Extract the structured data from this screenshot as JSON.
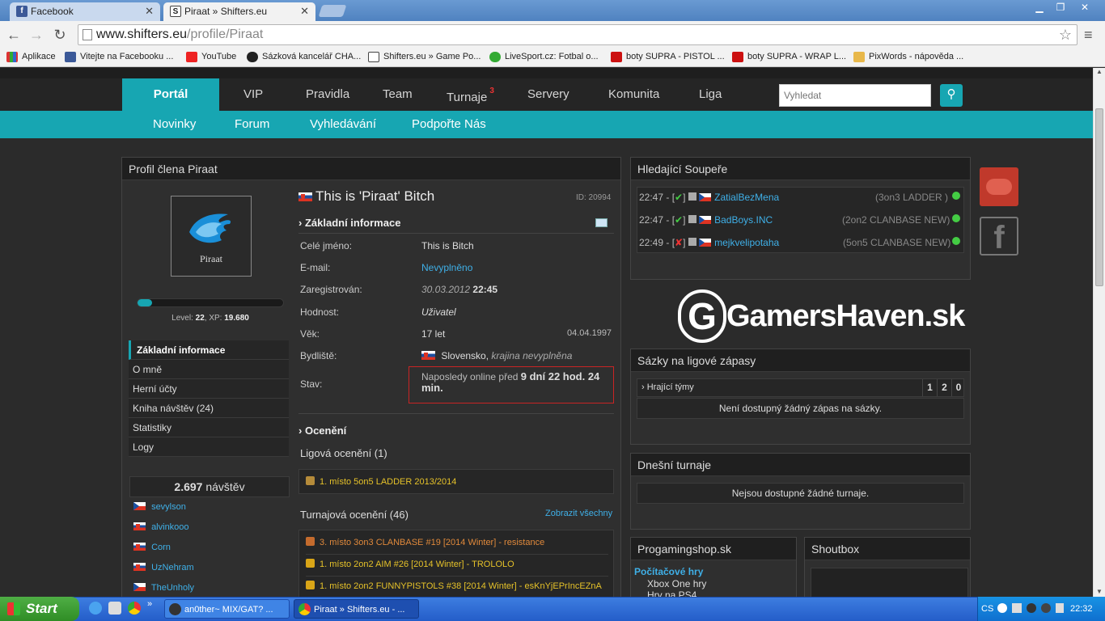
{
  "browser": {
    "tabs": [
      {
        "title": "Facebook",
        "icon": "facebook-icon"
      },
      {
        "title": "Piraat » Shifters.eu",
        "icon": "shifters-icon"
      }
    ],
    "url_host": "www.shifters.eu",
    "url_path": "/profile/Piraat",
    "bookmarks": [
      "Aplikace",
      "Vitejte na Facebooku ...",
      "YouTube",
      "Sázková kancelář CHA...",
      "Shifters.eu » Game Po...",
      "LiveSport.cz: Fotbal o...",
      "boty SUPRA - PISTOL ...",
      "boty SUPRA - WRAP L...",
      "PixWords - nápověda ..."
    ]
  },
  "site": {
    "nav": [
      "Portál",
      "VIP",
      "Pravidla",
      "Team",
      "Turnaje",
      "Servery",
      "Komunita",
      "Liga"
    ],
    "turnaje_badge": "3",
    "search_placeholder": "Vyhledat",
    "subnav": [
      "Novinky",
      "Forum",
      "Vyhledávání",
      "Podpořte Nás"
    ]
  },
  "profile": {
    "panel_title": "Profil člena Piraat",
    "avatar_name": "Piraat",
    "level_label": "Level:",
    "level": "22",
    "xp_label": ", XP:",
    "xp": "19.680",
    "xp_progress": 0.1,
    "menu": [
      "Základní informace",
      "O mně",
      "Herní účty",
      "Kniha návštěv (24)",
      "Statistiky",
      "Logy"
    ],
    "visits_count": "2.697",
    "visits_label": "návštěv",
    "visitors": [
      "sevylson",
      "alvinkooo",
      "Corn",
      "UzNehram",
      "TheUnholy"
    ],
    "headline": "This is 'Piraat' Bitch",
    "id": "ID: 20994",
    "basic_info_title": "Základní informace",
    "fields": {
      "fullname_label": "Celé jméno:",
      "fullname": "This is Bitch",
      "email_label": "E-mail:",
      "email": "Nevyplněno",
      "registered_label": "Zaregistrován:",
      "registered_date": "30.03.2012",
      "registered_time": "22:45",
      "rank_label": "Hodnost:",
      "rank": "Uživatel",
      "age_label": "Věk:",
      "age": "17 let",
      "birthdate": "04.04.1997",
      "residence_label": "Bydliště:",
      "country": "Slovensko,",
      "region": "krajina nevyplněna",
      "status_label": "Stav:",
      "status_prefix": "Naposledy online před",
      "status_value": "9 dní 22 hod. 24 min."
    },
    "awards_title": "Ocenění",
    "league_awards_label": "Ligová ocenění (1)",
    "league_awards": [
      "1. místo 5on5 LADDER 2013/2014"
    ],
    "tournament_awards_label": "Turnajová ocenění (46)",
    "show_all": "Zobrazit všechny",
    "tournament_awards": [
      "3. místo 3on3 CLANBASE #19 [2014 Winter] - resistance",
      "1. místo 2on2 AIM #26 [2014 Winter] - TROLOLO",
      "1. místo 2on2 FUNNYPISTOLS #38 [2014 Winter] - esKnYjEPrIncEZnA"
    ]
  },
  "opponents": {
    "title": "Hledající Soupeře",
    "rows": [
      {
        "time": "22:47 - [",
        "mark": "✔",
        "close": "]",
        "team": "ZatialBezMena",
        "mode": "(3on3 LADDER )"
      },
      {
        "time": "22:47 - [",
        "mark": "✔",
        "close": "]",
        "team": "BadBoys.INC",
        "mode": "(2on2 CLANBASE NEW)"
      },
      {
        "time": "22:49 - [",
        "mark": "✘",
        "close": "]",
        "team": "mejkvelipotaha",
        "mode": "(5on5 CLANBASE NEW)"
      }
    ]
  },
  "banner": {
    "text": "GamersHaven.sk",
    "initial": "G"
  },
  "bets": {
    "title": "Sázky na ligové zápasy",
    "playing_teams": "Hrající týmy",
    "cols": [
      "1",
      "2",
      "0"
    ],
    "empty": "Není dostupný žádný zápas na sázky."
  },
  "today": {
    "title": "Dnešní turnaje",
    "empty": "Nejsou dostupné žádné turnaje."
  },
  "shop": {
    "title": "Progamingshop.sk",
    "category": "Počítačové hry",
    "items": [
      "Xbox One hry",
      "Hry na PS4"
    ]
  },
  "shoutbox": {
    "title": "Shoutbox"
  },
  "taskbar": {
    "start": "Start",
    "items": [
      "an0ther~ MIX/GAT? ...",
      "Piraat » Shifters.eu - ..."
    ],
    "lang": "CS",
    "clock": "22:32"
  }
}
